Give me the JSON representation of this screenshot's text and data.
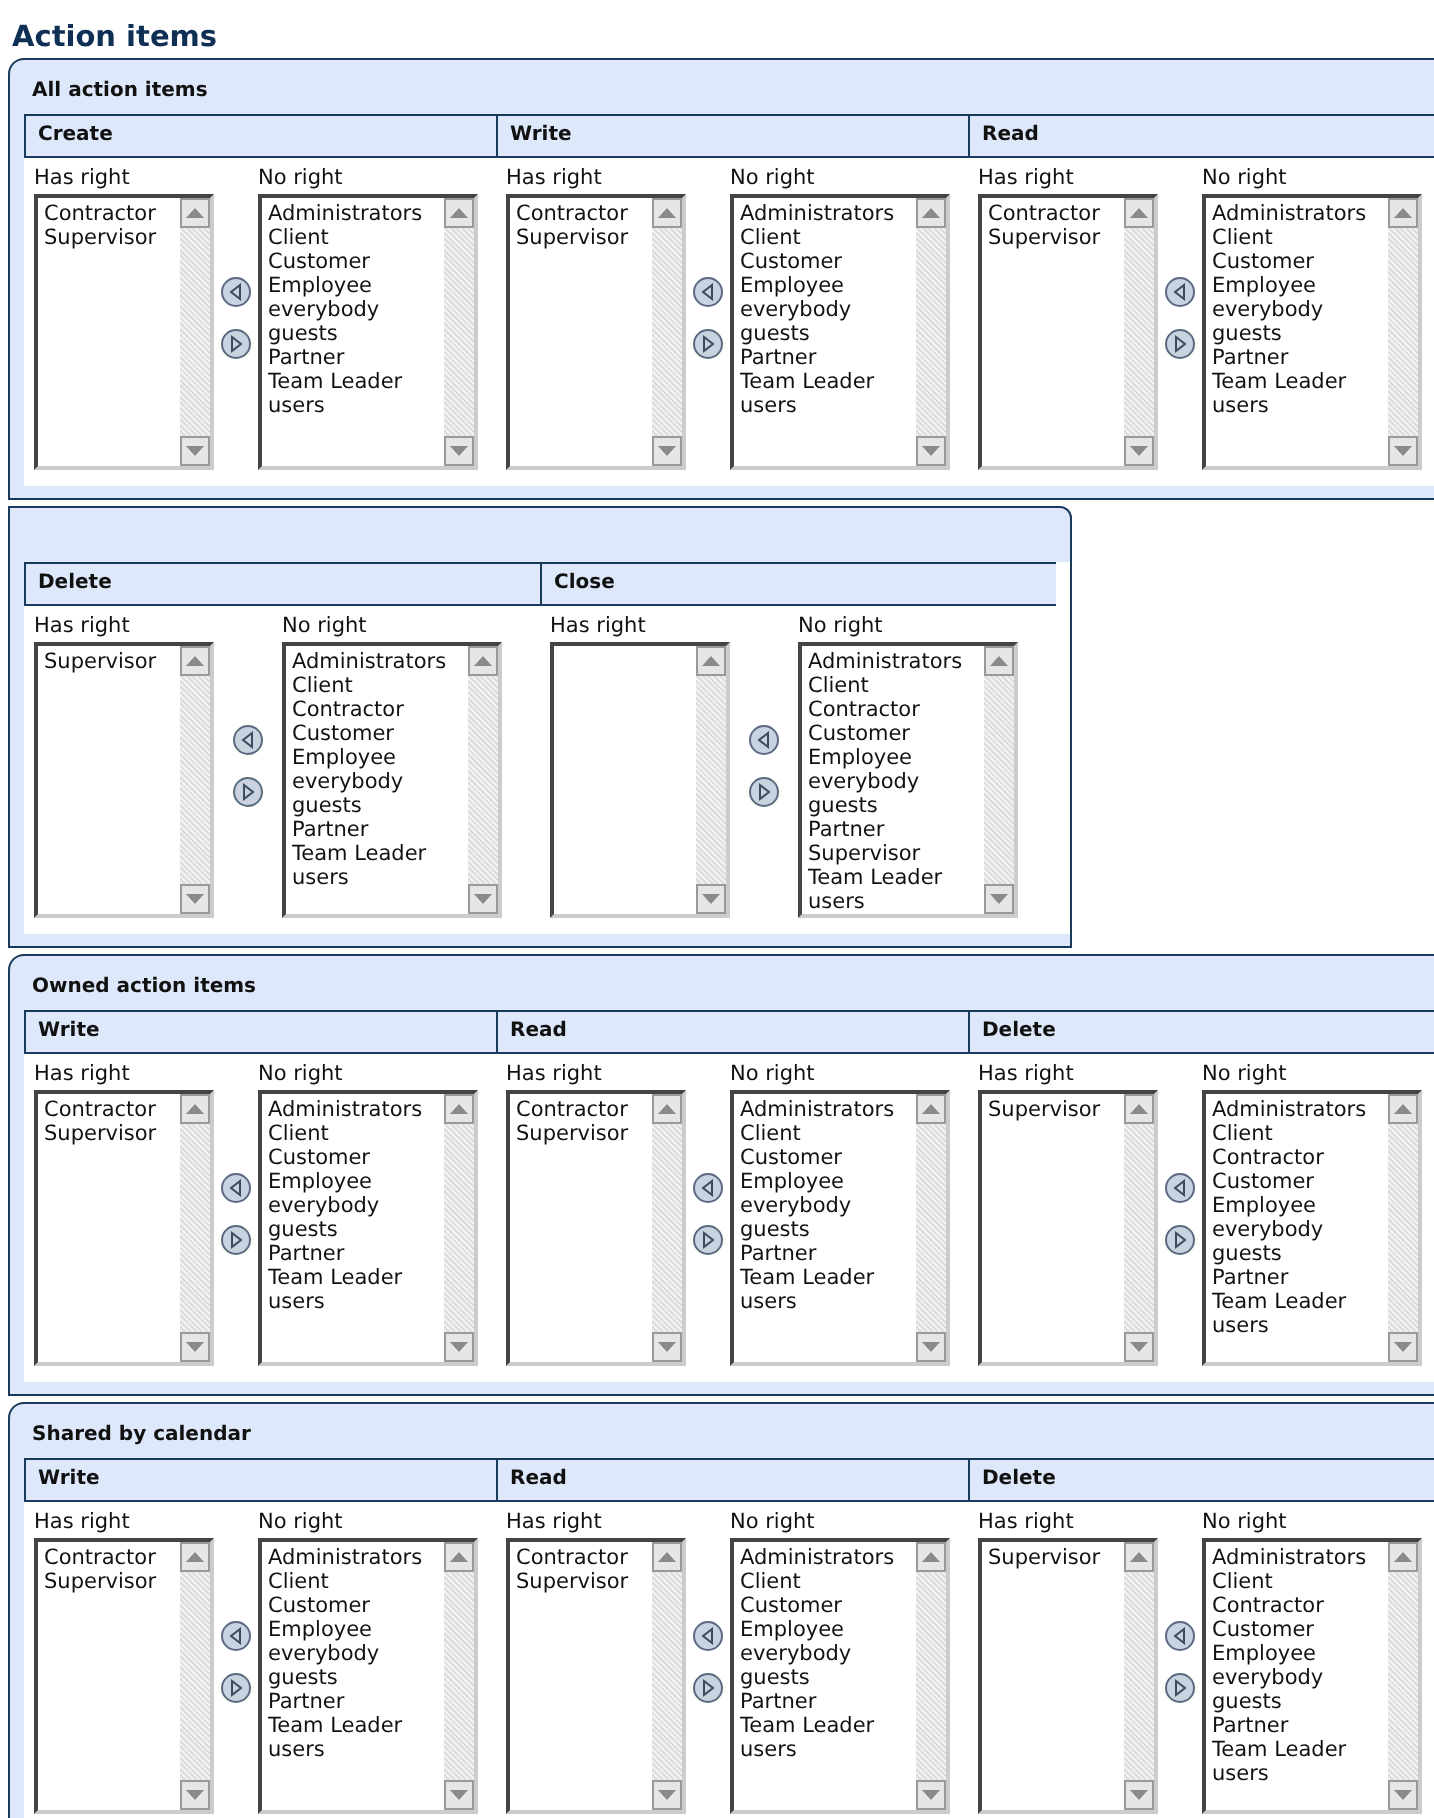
{
  "page_title": "Action items",
  "sections": [
    {
      "title": "All action items",
      "blocks": [
        {
          "name": "Create",
          "has_label": "Has right",
          "has_right": [
            "Contractor",
            "Supervisor"
          ],
          "no_label": "No right",
          "no_right": [
            "Administrators",
            "Client",
            "Customer",
            "Employee",
            "everybody",
            "guests",
            "Partner",
            "Team Leader",
            "users"
          ]
        },
        {
          "name": "Write",
          "has_label": "Has right",
          "has_right": [
            "Contractor",
            "Supervisor"
          ],
          "no_label": "No right",
          "no_right": [
            "Administrators",
            "Client",
            "Customer",
            "Employee",
            "everybody",
            "guests",
            "Partner",
            "Team Leader",
            "users"
          ]
        },
        {
          "name": "Read",
          "has_label": "Has right",
          "has_right": [
            "Contractor",
            "Supervisor"
          ],
          "no_label": "No right",
          "no_right": [
            "Administrators",
            "Client",
            "Customer",
            "Employee",
            "everybody",
            "guests",
            "Partner",
            "Team Leader",
            "users"
          ]
        }
      ]
    },
    {
      "blocks": [
        {
          "name": "Delete",
          "has_label": "Has right",
          "has_right": [
            "Supervisor"
          ],
          "no_label": "No right",
          "no_right": [
            "Administrators",
            "Client",
            "Contractor",
            "Customer",
            "Employee",
            "everybody",
            "guests",
            "Partner",
            "Team Leader",
            "users"
          ]
        },
        {
          "name": "Close",
          "has_label": "Has right",
          "no_label": "No right",
          "no_right": [
            "Administrators",
            "Client",
            "Contractor",
            "Customer",
            "Employee",
            "everybody",
            "guests",
            "Partner",
            "Supervisor",
            "Team Leader",
            "users"
          ]
        }
      ]
    },
    {
      "title": "Owned action items",
      "blocks": [
        {
          "name": "Write",
          "has_label": "Has right",
          "has_right": [
            "Contractor",
            "Supervisor"
          ],
          "no_label": "No right",
          "no_right": [
            "Administrators",
            "Client",
            "Customer",
            "Employee",
            "everybody",
            "guests",
            "Partner",
            "Team Leader",
            "users"
          ]
        },
        {
          "name": "Read",
          "has_label": "Has right",
          "has_right": [
            "Contractor",
            "Supervisor"
          ],
          "no_label": "No right",
          "no_right": [
            "Administrators",
            "Client",
            "Customer",
            "Employee",
            "everybody",
            "guests",
            "Partner",
            "Team Leader",
            "users"
          ]
        },
        {
          "name": "Delete",
          "has_label": "Has right",
          "has_right": [
            "Supervisor"
          ],
          "no_label": "No right",
          "no_right": [
            "Administrators",
            "Client",
            "Contractor",
            "Customer",
            "Employee",
            "everybody",
            "guests",
            "Partner",
            "Team Leader",
            "users"
          ]
        }
      ]
    },
    {
      "title": "Shared by calendar",
      "blocks": [
        {
          "name": "Write",
          "has_label": "Has right",
          "has_right": [
            "Contractor",
            "Supervisor"
          ],
          "no_label": "No right",
          "no_right": [
            "Administrators",
            "Client",
            "Customer",
            "Employee",
            "everybody",
            "guests",
            "Partner",
            "Team Leader",
            "users"
          ]
        },
        {
          "name": "Read",
          "has_label": "Has right",
          "has_right": [
            "Contractor",
            "Supervisor"
          ],
          "no_label": "No right",
          "no_right": [
            "Administrators",
            "Client",
            "Customer",
            "Employee",
            "everybody",
            "guests",
            "Partner",
            "Team Leader",
            "users"
          ]
        },
        {
          "name": "Delete",
          "has_label": "Has right",
          "has_right": [
            "Supervisor"
          ],
          "no_label": "No right",
          "no_right": [
            "Administrators",
            "Client",
            "Contractor",
            "Customer",
            "Employee",
            "everybody",
            "guests",
            "Partner",
            "Team Leader",
            "users"
          ]
        }
      ]
    }
  ]
}
